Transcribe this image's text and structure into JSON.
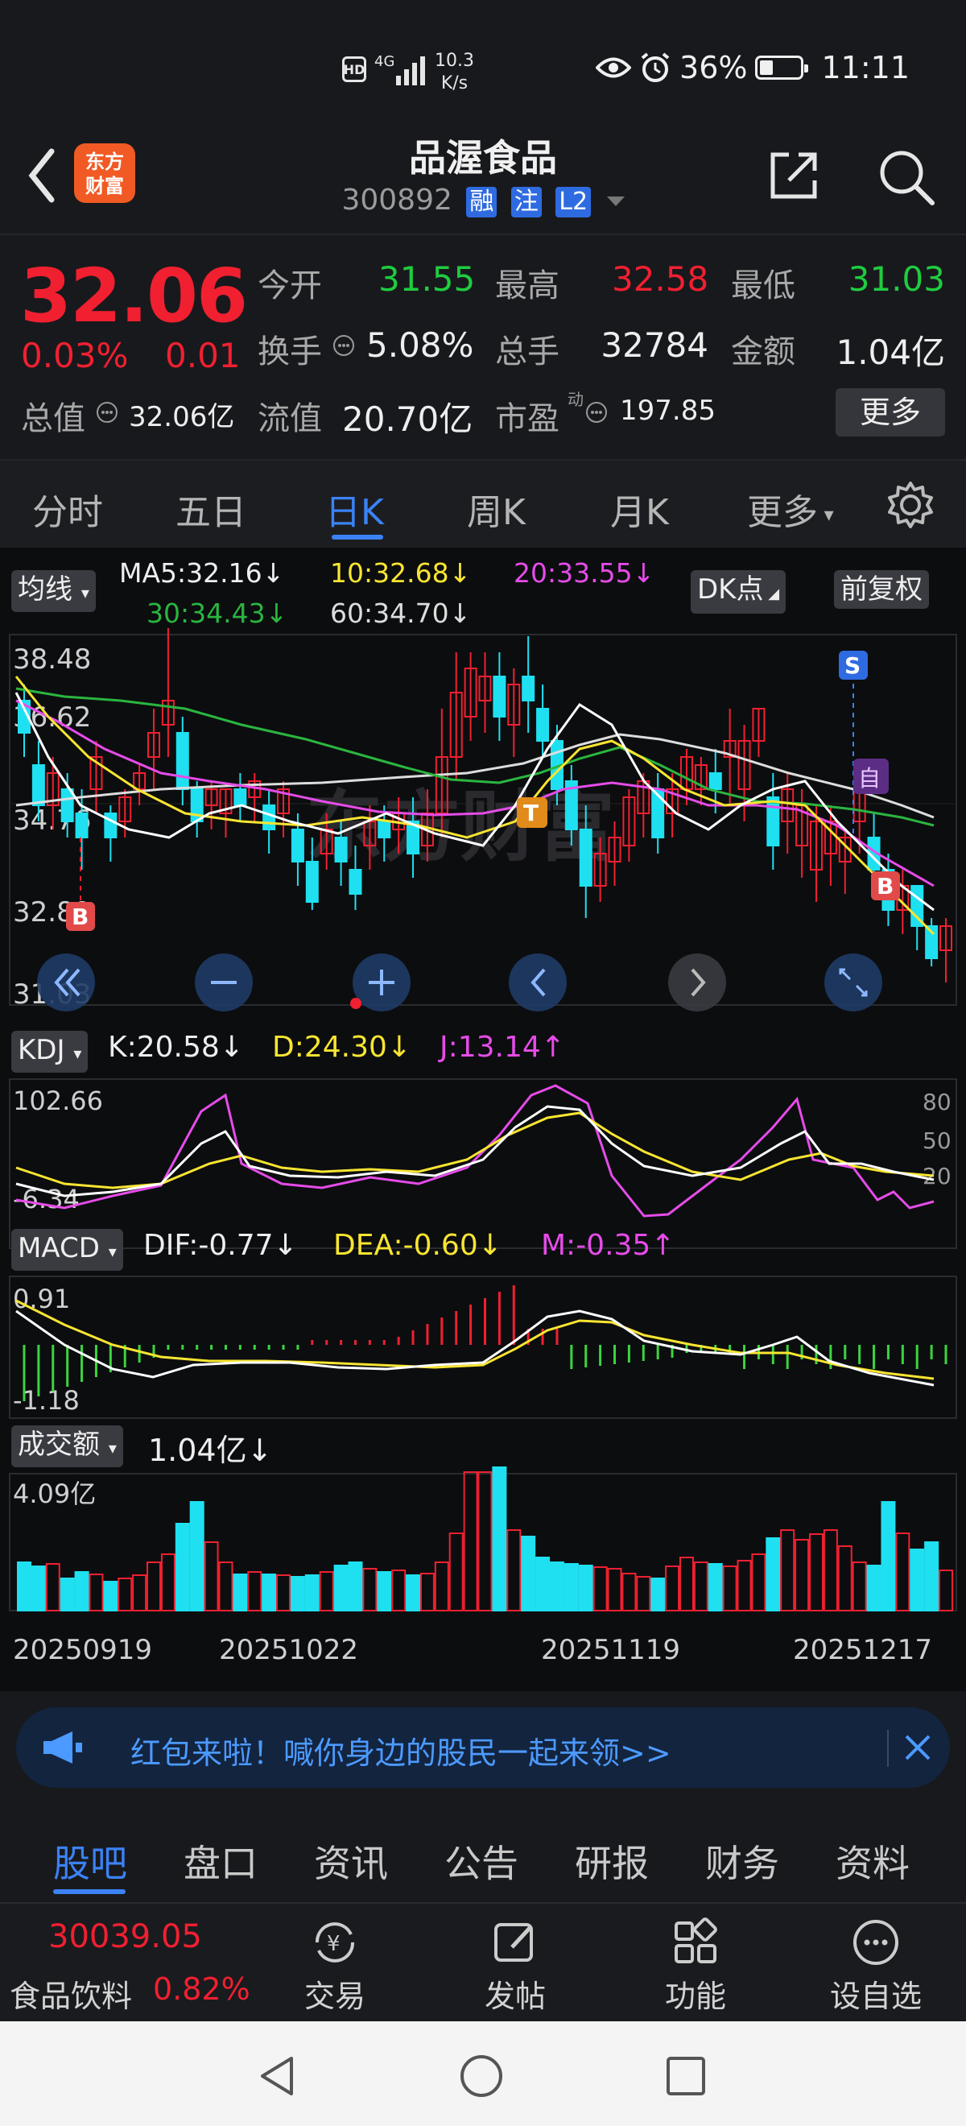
{
  "status_bar": {
    "hd": "HD",
    "network": "4G",
    "speed_value": "10.3",
    "speed_unit": "K/s",
    "battery": "36%",
    "time": "11:11"
  },
  "header": {
    "logo_line1": "东方",
    "logo_line2": "财富",
    "title": "品渥食品",
    "code": "300892",
    "tags": [
      "融",
      "注",
      "L2"
    ]
  },
  "quote": {
    "price": "32.06",
    "change_pct": "0.03%",
    "change": "0.01",
    "open_label": "今开",
    "open": "31.55",
    "high_label": "最高",
    "high": "32.58",
    "low_label": "最低",
    "low": "31.03",
    "turnover_label": "换手",
    "turnover": "5.08%",
    "volume_label": "总手",
    "volume": "32784",
    "amount_label": "金额",
    "amount": "1.04亿",
    "mcap_label": "总值",
    "mcap": "32.06亿",
    "float_label": "流值",
    "float": "20.70亿",
    "pe_label": "市盈",
    "pe_super": "动",
    "pe": "197.85",
    "more": "更多"
  },
  "tabs": [
    "分时",
    "五日",
    "日K",
    "周K",
    "月K",
    "更多"
  ],
  "active_tab": "日K",
  "ma_legend": {
    "selector": "均线",
    "ma5": "MA5:32.16↓",
    "ma10": "10:32.68↓",
    "ma20": "20:33.55↓",
    "ma30": "30:34.43↓",
    "ma60": "60:34.70↓",
    "dk_button": "DK点",
    "adjust_button": "前复权"
  },
  "main_chart": {
    "y_ticks": [
      "38.48",
      "36.62",
      "34.76",
      "32.89",
      "31.03"
    ],
    "markers": [
      "S",
      "自",
      "T",
      "B",
      "B"
    ],
    "watermark": "东方财富"
  },
  "kdj": {
    "selector": "KDJ",
    "k": "K:20.58↓",
    "d": "D:24.30↓",
    "j": "J:13.14↑",
    "y_top": "102.66",
    "y_bottom": "-6.34",
    "levels": [
      "80",
      "50",
      "20"
    ]
  },
  "macd": {
    "selector": "MACD",
    "dif": "DIF:-0.77↓",
    "dea": "DEA:-0.60↓",
    "m": "M:-0.35↑",
    "y_top": "0.91",
    "y_bottom": "-1.18"
  },
  "turnover_panel": {
    "selector": "成交额",
    "value": "1.04亿↓",
    "y_top": "4.09亿",
    "dates": [
      "20250919",
      "20251022",
      "20251119",
      "20251217"
    ]
  },
  "banner": {
    "text": "红包来啦！喊你身边的股民一起来领>>"
  },
  "subtabs": [
    "股吧",
    "盘口",
    "资讯",
    "公告",
    "研报",
    "财务",
    "资料"
  ],
  "active_subtab": "股吧",
  "bottom_bar": {
    "index_value": "30039.05",
    "index_name": "食品饮料",
    "index_change": "0.82%",
    "items": [
      "交易",
      "发帖",
      "功能",
      "设自选"
    ]
  },
  "colors": {
    "up": "#f02030",
    "down": "#1fe0f0",
    "accent": "#3b82f6",
    "ma5": "#ffffff",
    "ma10": "#f8e531",
    "ma20": "#e54ce8",
    "ma30": "#2ab53f",
    "ma60": "#dddddd"
  }
}
